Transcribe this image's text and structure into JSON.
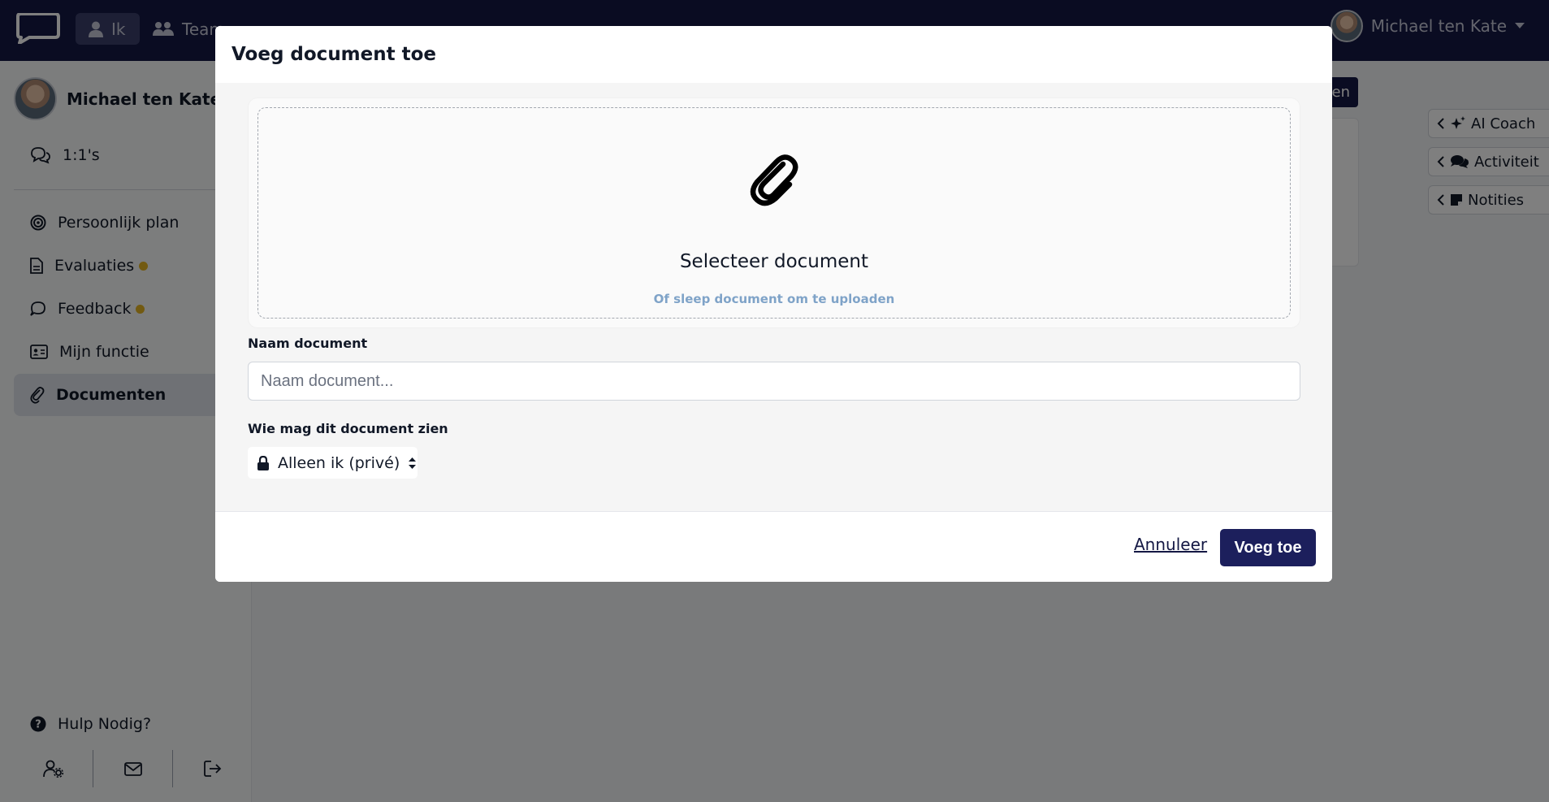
{
  "topbar": {
    "tabs": [
      {
        "label": "Ik",
        "icon": "user-icon"
      },
      {
        "label": "Team",
        "icon": "users-icon"
      }
    ],
    "user_name": "Michael ten Kate"
  },
  "sidebar": {
    "user_name": "Michael ten Kate",
    "items": [
      {
        "label": "1:1's",
        "icon": "chat-bubbles-icon"
      },
      {
        "label": "Persoonlijk plan",
        "icon": "target-icon"
      },
      {
        "label": "Evaluaties",
        "icon": "document-icon",
        "badge": true
      },
      {
        "label": "Feedback",
        "icon": "comment-icon",
        "badge": true
      },
      {
        "label": "Mijn functie",
        "icon": "id-card-icon"
      },
      {
        "label": "Documenten",
        "icon": "paperclip-icon",
        "active": true
      }
    ],
    "help_label": "Hulp Nodig?"
  },
  "right_panel": {
    "background_button_label": "en",
    "tabs": [
      {
        "label": "AI Coach",
        "icon": "sparkles-icon"
      },
      {
        "label": "Activiteit",
        "icon": "comments-icon"
      },
      {
        "label": "Notities",
        "icon": "sticky-note-icon"
      }
    ]
  },
  "modal": {
    "title": "Voeg document toe",
    "dropzone": {
      "title": "Selecteer document",
      "subtitle": "Of sleep document om te uploaden"
    },
    "name_label": "Naam document",
    "name_placeholder": "Naam document...",
    "name_value": "",
    "visibility_label": "Wie mag dit document zien",
    "visibility_value": "Alleen ik (privé)",
    "cancel_label": "Annuleer",
    "submit_label": "Voeg toe"
  },
  "colors": {
    "brand_navy": "#141844",
    "badge_yellow": "#e5b422",
    "dropzone_subtitle": "#7fa3c8"
  }
}
